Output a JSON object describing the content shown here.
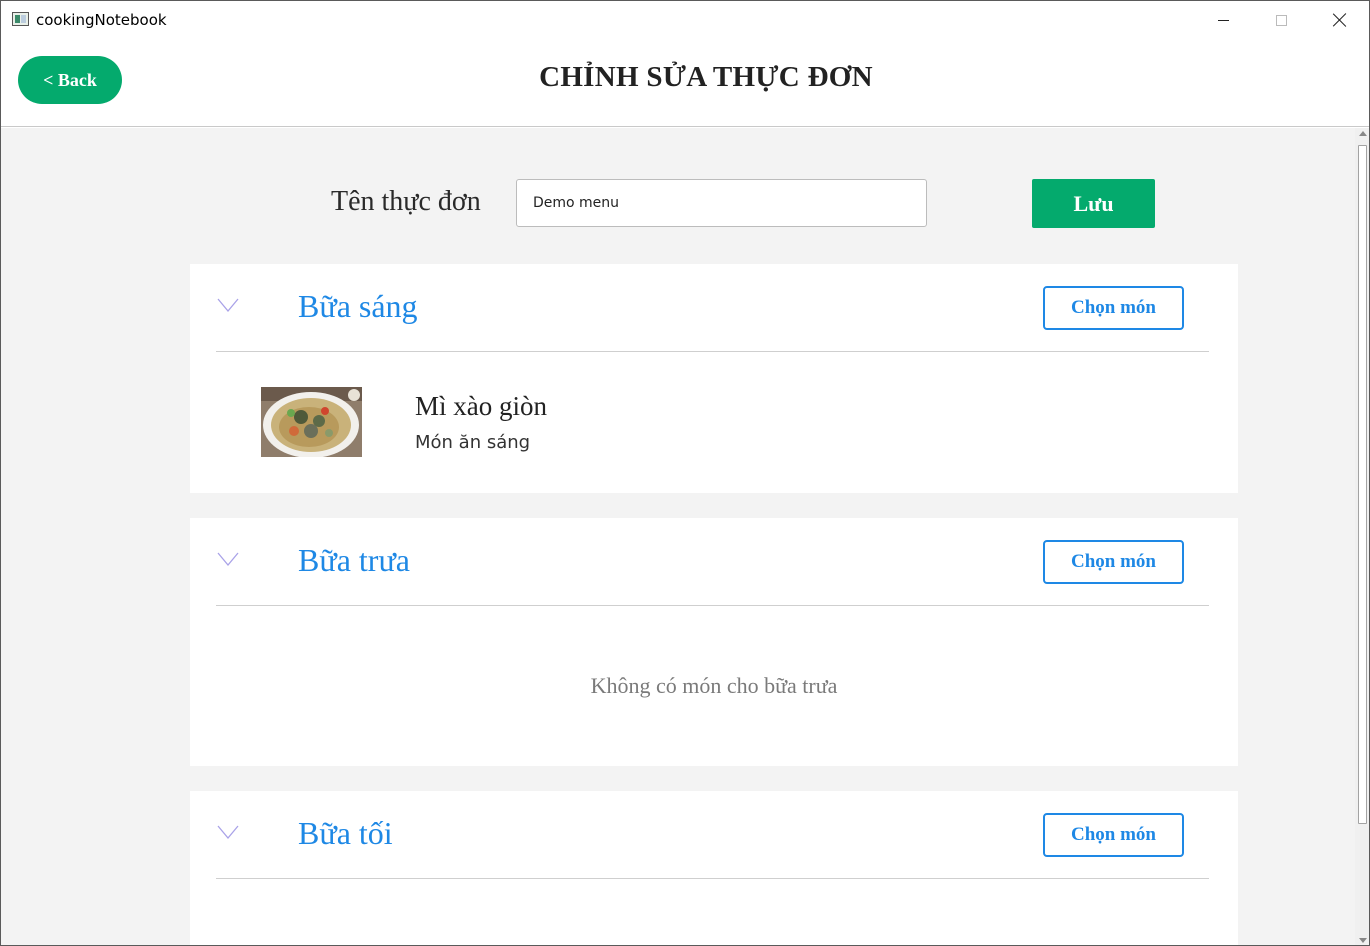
{
  "window": {
    "title": "cookingNotebook"
  },
  "header": {
    "back_label": "< Back",
    "title": "CHỈNH SỬA THỰC ĐƠN"
  },
  "form": {
    "name_label": "Tên thực đơn",
    "name_value": "Demo menu",
    "save_label": "Lưu"
  },
  "meals": [
    {
      "title": "Bữa sáng",
      "choose_label": "Chọn món",
      "dishes": [
        {
          "name": "Mì xào giòn",
          "category": "Món ăn sáng"
        }
      ]
    },
    {
      "title": "Bữa trưa",
      "choose_label": "Chọn món",
      "empty_text": "Không có món cho bữa trưa"
    },
    {
      "title": "Bữa tối",
      "choose_label": "Chọn món"
    }
  ],
  "colors": {
    "accent_green": "#04aa6d",
    "accent_blue": "#1e88e5",
    "chevron": "#a9a2e8"
  }
}
